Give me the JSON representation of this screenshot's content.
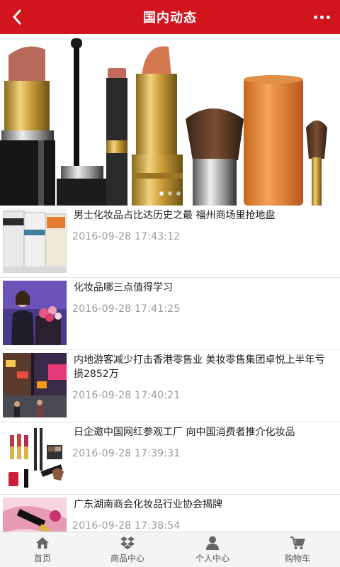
{
  "header": {
    "title": "国内动态",
    "back_icon": "chevron-left-icon",
    "more_icon": "more-dots-icon",
    "color": "#d2151d"
  },
  "banner": {
    "image": "cosmetics-banner",
    "slides": 3,
    "active_slide": 1
  },
  "news": [
    {
      "title": "男士化妆品占比达历史之最 福州商场里抢地盘",
      "date": "2016-09-28 17:43:12",
      "thumb": "men-cosmetics-tubes"
    },
    {
      "title": "化妆品哪三点值得学习",
      "date": "2016-09-28 17:41:25",
      "thumb": "speaker-stage"
    },
    {
      "title": "内地游客减少打击香港零售业 美妆零售集团卓悦上半年亏损2852万",
      "date": "2016-09-28 17:40:21",
      "thumb": "hongkong-street"
    },
    {
      "title": "日企邀中国网红参观工厂 向中国消费者推介化妆品",
      "date": "2016-09-28 17:39:31",
      "thumb": "makeup-products"
    },
    {
      "title": "广东湖南商会化妆品行业协会揭牌",
      "date": "2016-09-28 17:38:54",
      "thumb": "pink-makeup"
    }
  ],
  "tabbar": [
    {
      "label": "首页",
      "icon": "home-icon"
    },
    {
      "label": "商品中心",
      "icon": "dropbox-icon"
    },
    {
      "label": "个人中心",
      "icon": "user-icon"
    },
    {
      "label": "购物车",
      "icon": "cart-icon"
    }
  ],
  "colors": {
    "accent": "#d2151d",
    "date_text": "#9a9a9a",
    "tab_bg": "#f4f4f4"
  }
}
